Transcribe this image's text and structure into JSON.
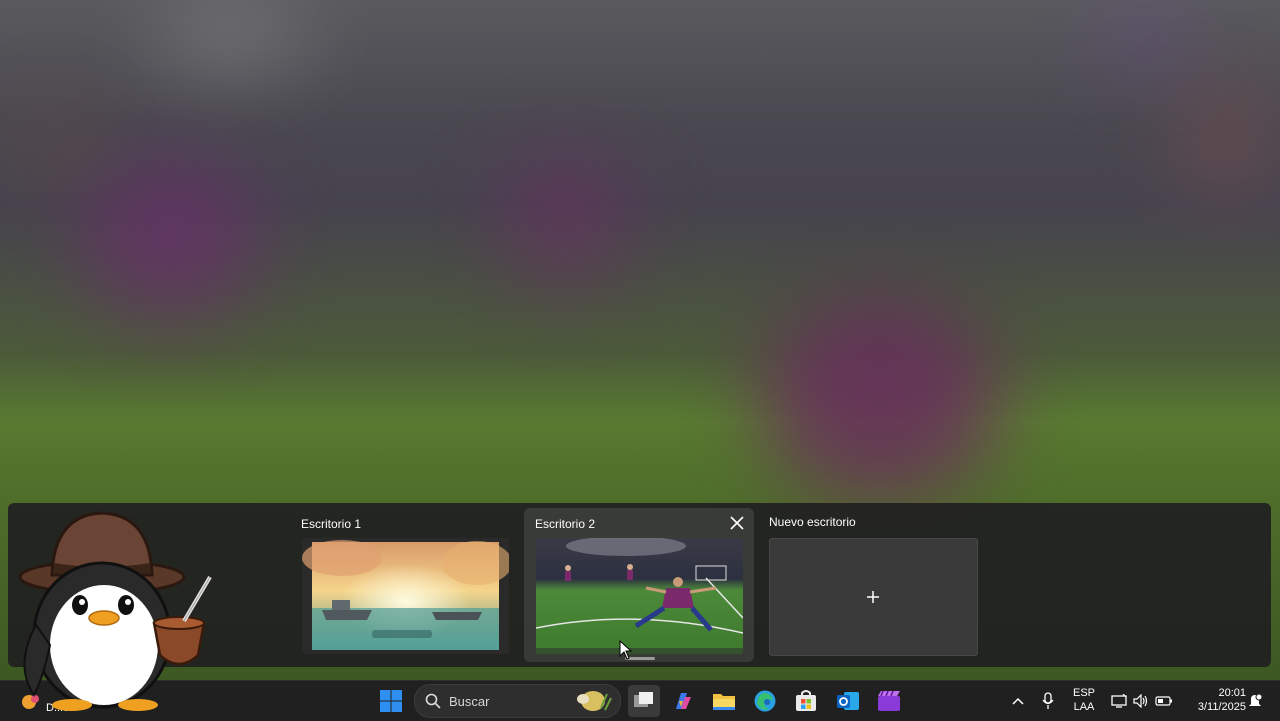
{
  "task_view": {
    "desktops": [
      {
        "label": "Escritorio 1",
        "thumbnail": "sunset-sea-ships-wallpaper",
        "active": false
      },
      {
        "label": "Escritorio 2",
        "thumbnail": "football-celebration-wallpaper",
        "active": true
      }
    ],
    "new_desktop": {
      "label": "Nuevo escritorio",
      "icon": "plus-icon"
    },
    "close_icon": "close-icon"
  },
  "taskbar": {
    "weather": {
      "text": "D...do",
      "icon": "weather-icon"
    },
    "start_icon": "windows-start-icon",
    "search": {
      "placeholder": "Buscar",
      "icon": "search-icon",
      "highlight_icon": "search-highlight-icon"
    },
    "apps": [
      {
        "name": "task-view",
        "icon": "task-view-icon"
      },
      {
        "name": "copilot",
        "icon": "copilot-icon"
      },
      {
        "name": "file-explorer",
        "icon": "folder-icon"
      },
      {
        "name": "edge",
        "icon": "edge-icon"
      },
      {
        "name": "microsoft-store",
        "icon": "store-icon"
      },
      {
        "name": "outlook",
        "icon": "outlook-icon"
      },
      {
        "name": "clipchamp",
        "icon": "clipchamp-icon"
      }
    ],
    "tray": {
      "chevron_icon": "chevron-up-icon",
      "mic_icon": "microphone-icon",
      "lang_line1": "ESP",
      "lang_line2": "LAA",
      "network_icon": "network-icon",
      "volume_icon": "volume-icon",
      "battery_icon": "battery-icon",
      "time": "20:01",
      "date": "3/11/2025",
      "notification_icon": "notification-icon"
    }
  },
  "colors": {
    "taskbar_bg": "#202020",
    "taskview_bg": "#202020",
    "windows_blue": "#2f8ff0"
  }
}
